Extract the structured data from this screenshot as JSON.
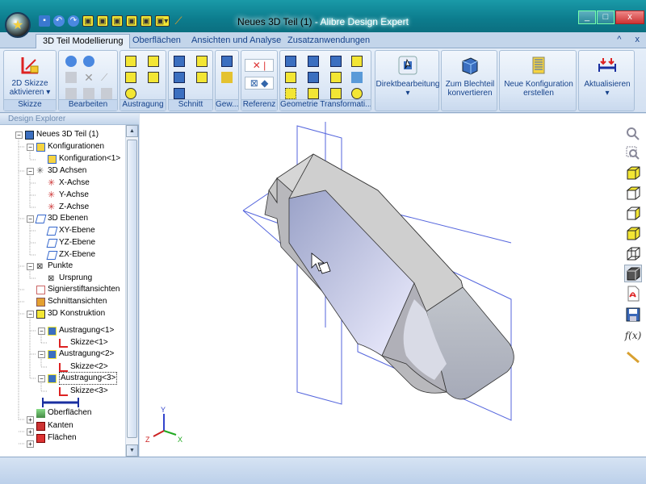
{
  "window": {
    "document_name": "Neues 3D Teil (1)",
    "separator": " - ",
    "app_name": "Alibre Design Expert",
    "min": "_",
    "max": "□",
    "close": "x"
  },
  "tabs": [
    "3D Teil Modellierung",
    "Oberflächen",
    "Ansichten und Analyse",
    "Zusatzanwendungen"
  ],
  "tab_controls": {
    "minimize": "^",
    "close": "x"
  },
  "ribbon": {
    "groups": [
      "Skizze",
      "Bearbeiten",
      "Austragung",
      "Schnitt",
      "Gew...",
      "Referenz",
      "Geometrie Transformati..."
    ],
    "skizze_button": {
      "line1": "2D Skizze",
      "line2": "aktivieren ▾"
    },
    "direct_edit": {
      "label": "Direktbearbeitung",
      "arrow": "▾"
    },
    "sheet_metal": {
      "line1": "Zum Blechteil",
      "line2": "konvertieren"
    },
    "new_config": {
      "line1": "Neue Konfiguration",
      "line2": "erstellen"
    },
    "update": {
      "label": "Aktualisieren",
      "arrow": "▾"
    }
  },
  "design_explorer": {
    "title": "Design Explorer",
    "nodes": [
      {
        "label": "Neues 3D Teil (1)",
        "icon": "part-icon"
      },
      {
        "label": "Konfigurationen",
        "icon": "config-icon"
      },
      {
        "label": "Konfiguration<1>",
        "icon": "config-icon"
      },
      {
        "label": "3D Achsen",
        "icon": "axis-icon"
      },
      {
        "label": "X-Achse",
        "icon": "axis-icon"
      },
      {
        "label": "Y-Achse",
        "icon": "axis-icon"
      },
      {
        "label": "Z-Achse",
        "icon": "axis-icon"
      },
      {
        "label": "3D Ebenen",
        "icon": "plane-icon"
      },
      {
        "label": "XY-Ebene",
        "icon": "plane-icon"
      },
      {
        "label": "YZ-Ebene",
        "icon": "plane-icon"
      },
      {
        "label": "ZX-Ebene",
        "icon": "plane-icon"
      },
      {
        "label": "Punkte",
        "icon": "point-icon"
      },
      {
        "label": "Ursprung",
        "icon": "point-icon"
      },
      {
        "label": "Signierstiftansichten",
        "icon": "pen-view-icon"
      },
      {
        "label": "Schnittansichten",
        "icon": "section-icon"
      },
      {
        "label": "3D Konstruktion",
        "icon": "construction-icon"
      },
      {
        "label": "Austragung<1>",
        "icon": "extrude-icon"
      },
      {
        "label": "Skizze<1>",
        "icon": "sketch-icon"
      },
      {
        "label": "Austragung<2>",
        "icon": "extrude-icon"
      },
      {
        "label": "Skizze<2>",
        "icon": "sketch-icon"
      },
      {
        "label": "Austragung<3>",
        "icon": "extrude-icon"
      },
      {
        "label": "Skizze<3>",
        "icon": "sketch-icon"
      },
      {
        "label": "Oberflächen",
        "icon": "surface-icon"
      },
      {
        "label": "Kanten",
        "icon": "edge-icon"
      },
      {
        "label": "Flächen",
        "icon": "face-icon"
      }
    ]
  },
  "triad": {
    "x": "X",
    "y": "Y",
    "z": "Z"
  },
  "right_toolbar": [
    "zoom-icon",
    "zoom-window-icon",
    "view-front-icon",
    "view-top-icon",
    "view-right-icon",
    "view-iso-icon",
    "wireframe-icon",
    "shaded-icon",
    "pdf-icon",
    "save-icon",
    "function-icon",
    "measure-icon"
  ],
  "colors": {
    "ribbon_text": "#15428b",
    "cube_yellow": "#f3e634",
    "part_shade": "#c8c8c8",
    "plane_line": "#5566dd"
  }
}
